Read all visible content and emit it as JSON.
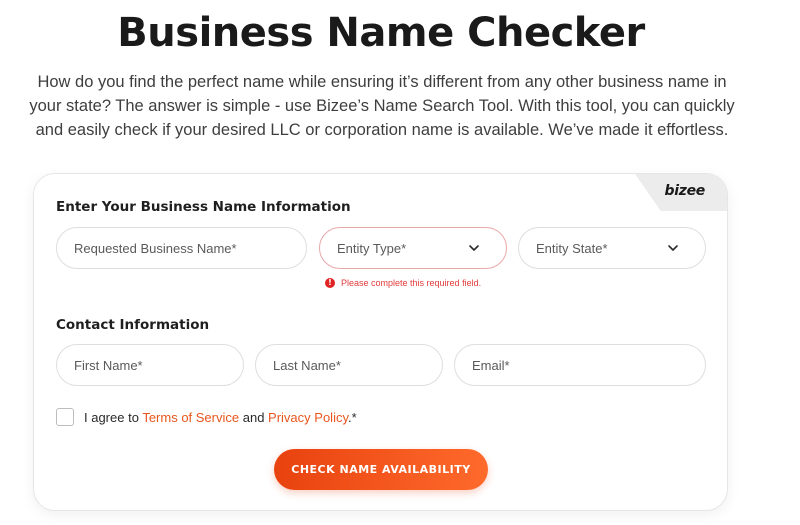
{
  "page": {
    "title": "Business Name Checker",
    "intro": "How do you find the perfect name while ensuring it’s different from any other business name in your state? The answer is simple - use Bizee’s Name Search Tool. With this tool, you can quickly and easily check if your desired LLC or corporation name is available. We’ve made it effortless."
  },
  "card": {
    "brand": "bizee",
    "business_section_title": "Enter Your Business Name Information",
    "business_fields": {
      "name": "Requested Business Name*",
      "entity_type": "Entity Type*",
      "entity_state": "Entity State*"
    },
    "error_message": "Please complete this required field.",
    "error_icon": "!",
    "contact_section_title": "Contact Information",
    "contact_fields": {
      "first_name": "First Name*",
      "last_name": "Last Name*",
      "email": "Email*"
    },
    "agree": {
      "prefix": "I agree to ",
      "terms": "Terms of Service",
      "and": " and ",
      "privacy": "Privacy Policy",
      "suffix": ".*"
    },
    "cta_label": "CHECK NAME AVAILABILITY"
  },
  "colors": {
    "accent": "#e8561e",
    "error": "#e02424",
    "button_start": "#e8420f",
    "button_end": "#ff6a2b"
  }
}
